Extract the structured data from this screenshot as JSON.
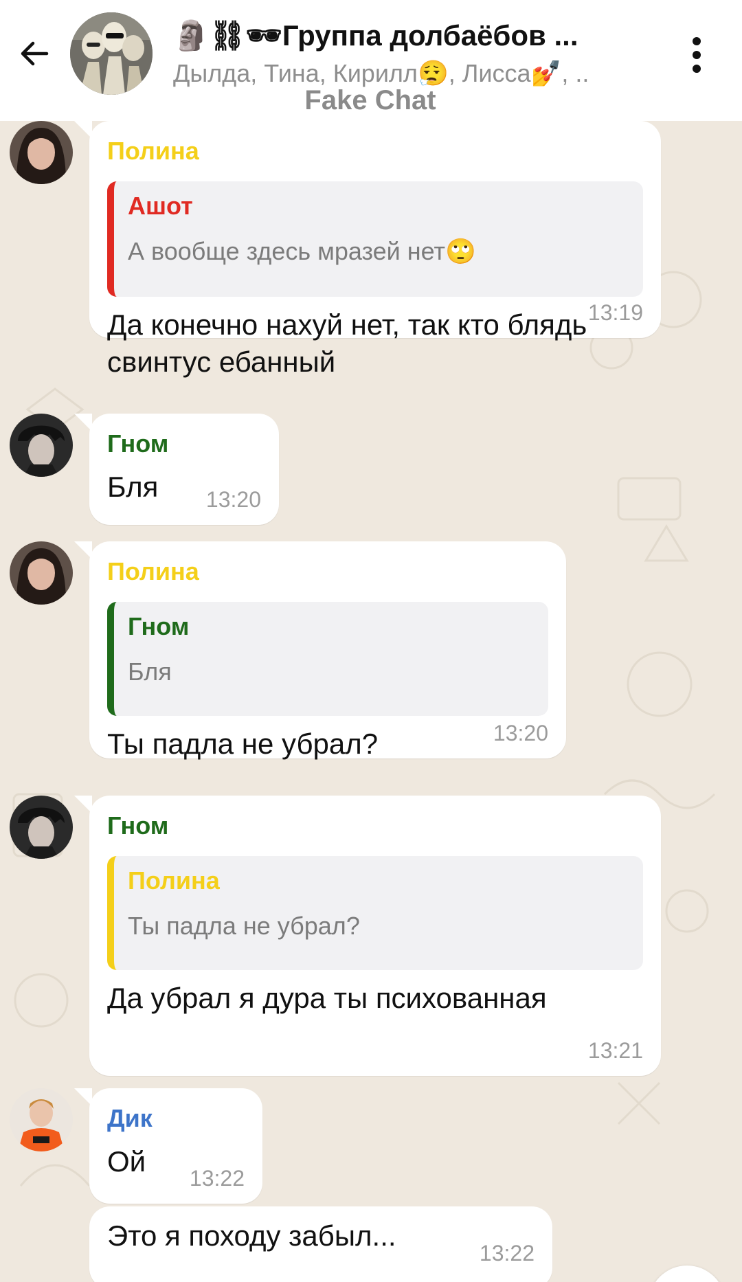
{
  "header": {
    "title": "🗿⛓🕶Группа долбаёбов ...",
    "members": "Дылда, Тина, Кирилл😮‍💨, Лисса💅, ..",
    "watermark": "Fake Chat"
  },
  "messages": [
    {
      "sender": "Полина",
      "quote": {
        "name": "Ашот",
        "text": "А вообще здесь мразей нет🙄"
      },
      "text": "Да конечно нахуй нет, так кто блядь свинтус ебанный",
      "time": "13:19"
    },
    {
      "sender": "Гном",
      "text": "Бля",
      "time": "13:20"
    },
    {
      "sender": "Полина",
      "quote": {
        "name": "Гном",
        "text": "Бля"
      },
      "text": "Ты падла не убрал?",
      "time": "13:20"
    },
    {
      "sender": "Гном",
      "quote": {
        "name": "Полина",
        "text": "Ты падла не убрал?"
      },
      "text": "Да убрал я дура ты психованная",
      "time": "13:21"
    },
    {
      "sender": "Дик",
      "text": "Ой",
      "time": "13:22"
    },
    {
      "text": "Это я походу забыл...",
      "time": "13:22"
    }
  ],
  "colors": {
    "polina": "#f4cf19",
    "gnom": "#1f6b1b",
    "ashot": "#e02a22",
    "dik": "#3d74c9",
    "chat_bg": "#efe8de"
  },
  "icons": [
    "back-arrow-icon",
    "more-vertical-icon",
    "scroll-down-icon"
  ]
}
